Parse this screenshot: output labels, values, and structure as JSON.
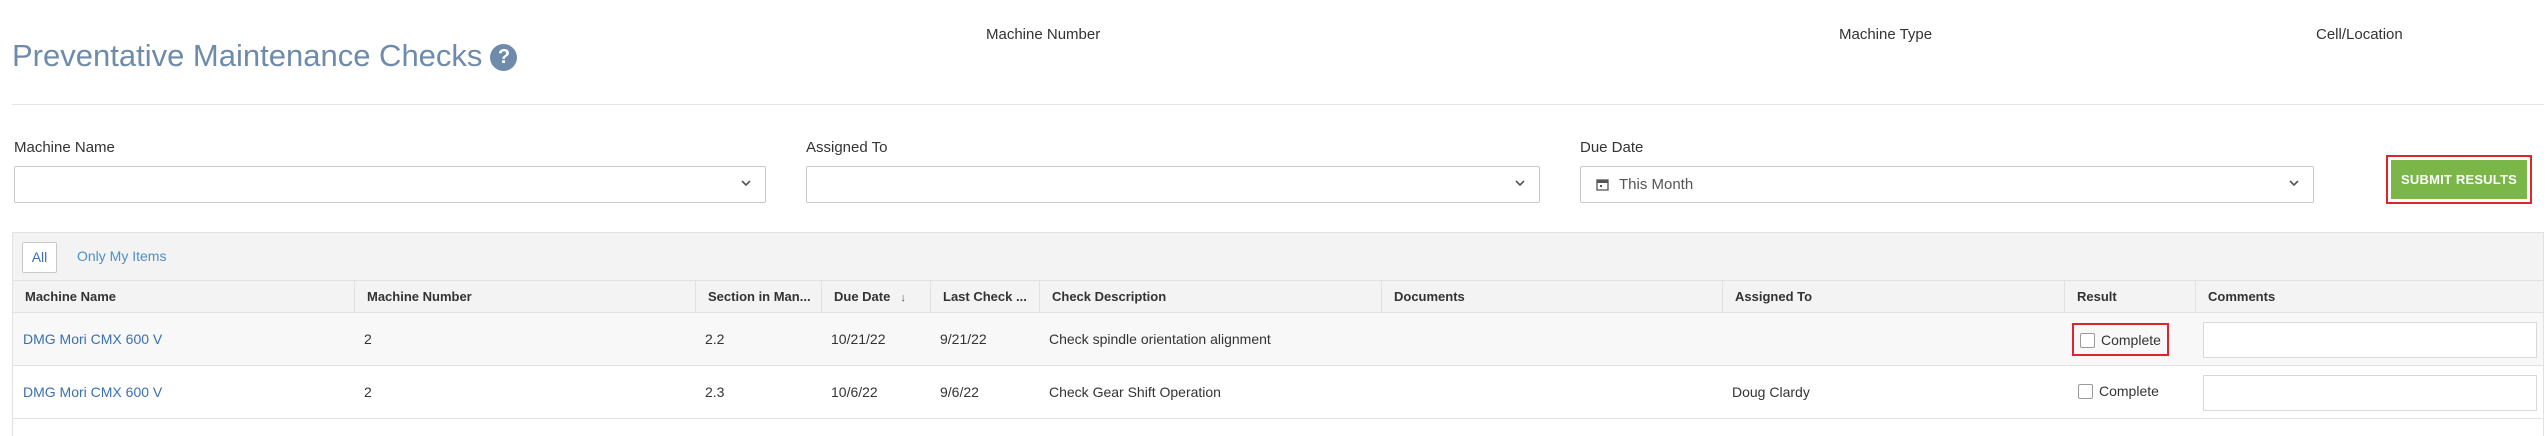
{
  "header": {
    "title": "Preventative Maintenance Checks",
    "help_symbol": "?",
    "machine_number_label": "Machine Number",
    "machine_type_label": "Machine Type",
    "cell_location_label": "Cell/Location"
  },
  "filters": {
    "machine_name": {
      "label": "Machine Name",
      "value": ""
    },
    "assigned_to": {
      "label": "Assigned To",
      "value": ""
    },
    "due_date": {
      "label": "Due Date",
      "value": "This Month"
    }
  },
  "actions": {
    "submit_label": "SUBMIT RESULTS"
  },
  "grid": {
    "tabs": {
      "all": "All",
      "mine": "Only My Items"
    },
    "columns": {
      "machine_name": "Machine Name",
      "machine_number": "Machine Number",
      "section": "Section in Man...",
      "due_date": "Due Date",
      "due_sort": "↓",
      "last_check": "Last Check ...",
      "check_description": "Check Description",
      "documents": "Documents",
      "assigned_to": "Assigned To",
      "result": "Result",
      "comments": "Comments"
    },
    "rows": [
      {
        "machine_name": "DMG Mori CMX 600 V",
        "machine_number": "2",
        "section": "2.2",
        "due_date": "10/21/22",
        "last_check": "9/21/22",
        "check_description": "Check spindle orientation alignment",
        "documents": "",
        "assigned_to": "",
        "result_label": "Complete",
        "comment": ""
      },
      {
        "machine_name": "DMG Mori CMX 600 V",
        "machine_number": "2",
        "section": "2.3",
        "due_date": "10/6/22",
        "last_check": "9/6/22",
        "check_description": "Check Gear Shift Operation",
        "documents": "",
        "assigned_to": "Doug Clardy",
        "result_label": "Complete",
        "comment": ""
      }
    ]
  },
  "colors": {
    "title": "#6f8bab",
    "link": "#3a6fb0",
    "submit": "#7ab648",
    "highlight": "#d9272e"
  }
}
